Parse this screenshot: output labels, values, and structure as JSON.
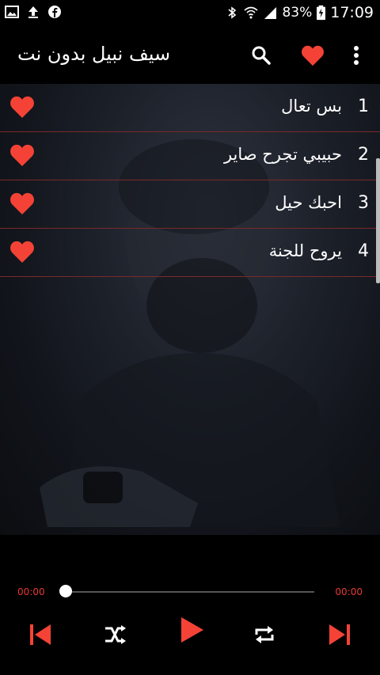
{
  "status": {
    "battery": "83%",
    "time": "17:09",
    "icons_left": [
      "image-icon",
      "upload-icon",
      "facebook-icon"
    ],
    "icons_right": [
      "bluetooth-icon",
      "wifi-icon",
      "signal-icon",
      "battery-icon"
    ]
  },
  "appbar": {
    "title": "سيف نبيل بدون نت",
    "icons": [
      "search-icon",
      "heart-icon",
      "more-vert-icon"
    ]
  },
  "songs": [
    {
      "number": "1",
      "title": "بس تعال"
    },
    {
      "number": "2",
      "title": "حبيبي تجرح صاير"
    },
    {
      "number": "3",
      "title": "احبك حيل"
    },
    {
      "number": "4",
      "title": "يروح للجنة"
    }
  ],
  "player": {
    "current_time": "00:00",
    "total_time": "00:00",
    "progress": 0,
    "controls": [
      "skip-previous-icon",
      "shuffle-icon",
      "play-icon",
      "repeat-icon",
      "skip-next-icon"
    ]
  },
  "colors": {
    "accent": "#f44336",
    "divider": "#7a2a2a",
    "time_text": "#e53935"
  }
}
